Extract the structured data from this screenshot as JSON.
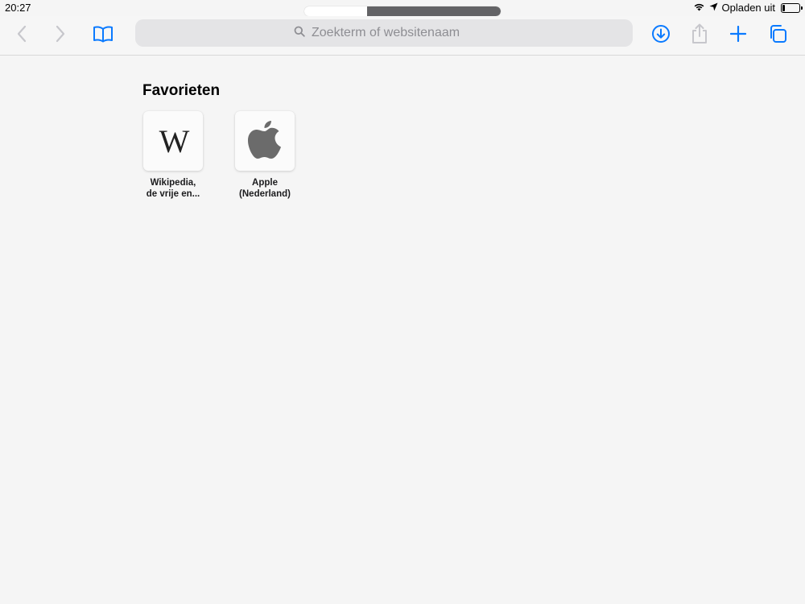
{
  "status_bar": {
    "time": "20:27",
    "charging_text": "Opladen uit",
    "battery_level": 0.15
  },
  "top_handle": {
    "progress": 0.68
  },
  "toolbar": {
    "back_icon": "chevron-left-icon",
    "forward_icon": "chevron-right-icon",
    "bookmarks_icon": "book-icon",
    "download_icon": "download-arrow-circle-icon",
    "share_icon": "share-icon",
    "new_tab_icon": "plus-icon",
    "tabs_icon": "tabs-overview-icon",
    "accent_color": "#0a7aff",
    "disabled_color": "#c7c7cc"
  },
  "search": {
    "placeholder": "Zoekterm of websitenaam",
    "value": ""
  },
  "favorites": {
    "title": "Favorieten",
    "items": [
      {
        "label_line1": "Wikipedia,",
        "label_line2": "de vrije en...",
        "icon": "wikipedia-w-icon"
      },
      {
        "label_line1": "Apple",
        "label_line2": "(Nederland)",
        "icon": "apple-logo-icon"
      }
    ]
  }
}
